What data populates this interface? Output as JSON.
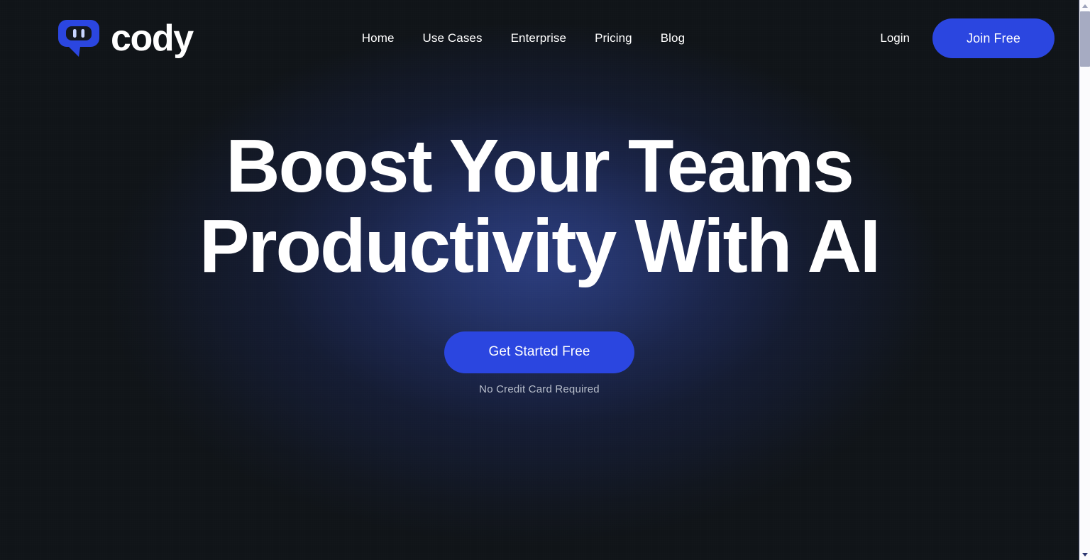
{
  "page": {
    "title": "Cody — Boost Your Teams Productivity With AI",
    "background_color": "#101418",
    "glow_color": "#2c3e80",
    "accent_color": "#2b46e0"
  },
  "header": {
    "brand": {
      "name": "cody",
      "logo_icon": "cody-chat-bot-logo-icon",
      "logo_color": "#2b46e0",
      "eye_color": "#c9d6ff"
    },
    "nav": [
      {
        "label": "Home",
        "name": "nav-link-home"
      },
      {
        "label": "Use Cases",
        "name": "nav-link-use-cases"
      },
      {
        "label": "Enterprise",
        "name": "nav-link-enterprise"
      },
      {
        "label": "Pricing",
        "name": "nav-link-pricing"
      },
      {
        "label": "Blog",
        "name": "nav-link-blog"
      }
    ],
    "login_label": "Login",
    "join_label": "Join Free"
  },
  "hero": {
    "title_line_1": "Boost Your Teams",
    "title_line_2": "Productivity With AI",
    "cta_label": "Get Started Free",
    "cta_note": "No Credit Card Required"
  },
  "scrollbar": {
    "up_arrow_icon": "chevron-up-icon",
    "down_arrow_icon": "chevron-down-icon",
    "thumb_label": "vertical-scroll-thumb"
  }
}
